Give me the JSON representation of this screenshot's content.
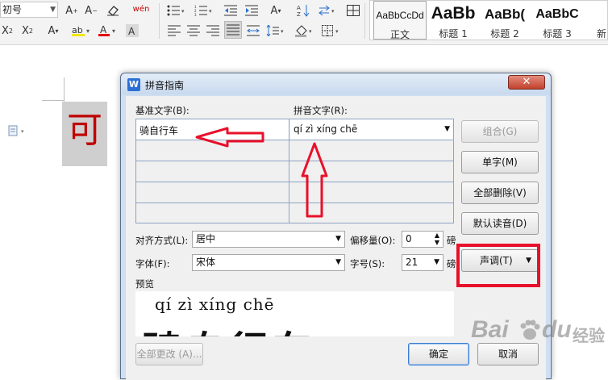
{
  "ribbon": {
    "font_size_value": "初号",
    "pinyin_guide_label": "wén",
    "styles": [
      {
        "preview": "AaBbCcDd",
        "caption": "正文",
        "active": true
      },
      {
        "preview": "AaBb",
        "caption": "标题 1"
      },
      {
        "preview": "AaBb(",
        "caption": "标题 2"
      },
      {
        "preview": "AaBbC",
        "caption": "标题 3"
      }
    ],
    "new_style_label": "新"
  },
  "document": {
    "char": "可"
  },
  "dialog": {
    "title": "拼音指南",
    "app_icon_letter": "W",
    "close_label": "✕",
    "base_text_label": "基准文字(B):",
    "pinyin_text_label": "拼音文字(R):",
    "rows": [
      {
        "base": "骑自行车",
        "pinyin": "qí zì xíng chē"
      },
      {
        "base": "",
        "pinyin": ""
      },
      {
        "base": "",
        "pinyin": ""
      },
      {
        "base": "",
        "pinyin": ""
      },
      {
        "base": "",
        "pinyin": ""
      }
    ],
    "side_buttons": {
      "group": "组合(G)",
      "single": "单字(M)",
      "delete_all": "全部删除(V)",
      "default_reading": "默认读音(D)",
      "tone": "声调(T)"
    },
    "align_label": "对齐方式(L):",
    "align_value": "居中",
    "offset_label": "偏移量(O):",
    "offset_value": "0",
    "offset_unit": "磅",
    "font_label": "字体(F):",
    "font_value": "宋体",
    "size_label": "字号(S):",
    "size_value": "21",
    "size_unit": "磅",
    "preview_label": "预览",
    "preview_pinyin": "qí zì xíng chē",
    "preview_hanzi": "骑自行车",
    "change_all": "全部更改 (A)...",
    "ok": "确定",
    "cancel": "取消"
  },
  "watermark": {
    "bai": "Bai",
    "du": "du",
    "jingyan": "经验"
  },
  "colors": {
    "annotation_red": "#e8102a",
    "doc_char_red": "#c00000",
    "dialog_frame": "#cfdff1"
  }
}
